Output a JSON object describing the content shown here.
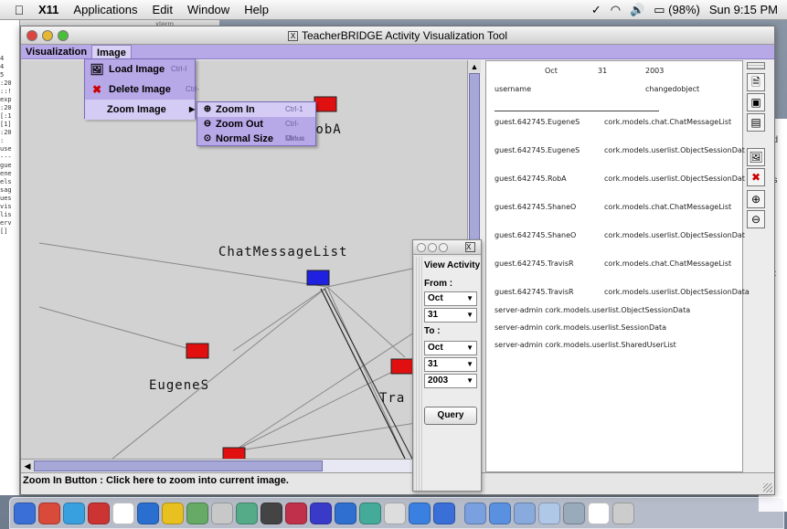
{
  "menubar": {
    "app": "X11",
    "items": [
      "Applications",
      "Edit",
      "Window",
      "Help"
    ],
    "battery": "(98%)",
    "clock": "Sun 9:15 PM"
  },
  "xterm": {
    "title": "xterm",
    "lines": [
      "4",
      "4",
      "5",
      ":20",
      "::!",
      "exp",
      ":20",
      "[:1",
      "[1]",
      ":20",
      ":",
      "use",
      "---",
      "",
      "gue",
      "ene",
      "els",
      "sag",
      "ues",
      "vis",
      "lis",
      "erv",
      "[]"
    ]
  },
  "window": {
    "title": "TeacherBRIDGE Activity Visualization Tool",
    "menus": [
      "Visualization",
      "Image"
    ]
  },
  "image_menu": {
    "items": [
      {
        "label": "Load Image",
        "accel": "Ctrl-I",
        "icon": "load-image-icon"
      },
      {
        "label": "Delete Image",
        "accel": "Ctrl-D",
        "icon": "delete-image-icon"
      },
      {
        "label": "Zoom Image",
        "accel": "",
        "icon": ""
      }
    ],
    "zoom_submenu": [
      {
        "label": "Zoom In",
        "accel": "Ctrl-1",
        "icon": "zoom-in-icon"
      },
      {
        "label": "Zoom Out",
        "accel": "Ctrl-Minus",
        "icon": "zoom-out-icon"
      },
      {
        "label": "Normal Size",
        "accel": "Ctrl-=",
        "icon": "normal-size-icon"
      }
    ]
  },
  "graph_labels": {
    "robA": "RobA",
    "chat": "ChatMessageList",
    "eugene": "EugeneS",
    "travis": "Tra"
  },
  "log": {
    "date": [
      "Oct",
      "31",
      "2003"
    ],
    "headers": [
      "username",
      "changedobject"
    ],
    "rows": [
      [
        "guest.642745.EugeneS",
        "cork.models.chat.ChatMessageList"
      ],
      [
        "guest.642745.EugeneS",
        "cork.models.userlist.ObjectSessionData"
      ],
      [
        "guest.642745.RobA",
        "cork.models.userlist.ObjectSessionData"
      ],
      [
        "guest.642745.ShaneO",
        "cork.models.chat.ChatMessageList"
      ],
      [
        "guest.642745.ShaneO",
        "cork.models.userlist.ObjectSessionData"
      ],
      [
        "guest.642745.TravisR",
        "cork.models.chat.ChatMessageList"
      ],
      [
        "guest.642745.TravisR",
        "cork.models.userlist.ObjectSessionData"
      ]
    ],
    "server_rows": [
      "server-admin  cork.models.userlist.ObjectSessionData",
      "server-admin  cork.models.userlist.SessionData",
      "server-admin  cork.models.userlist.SharedUserList"
    ]
  },
  "view_activity": {
    "title": "View Activity",
    "from_label": "From :",
    "to_label": "To :",
    "from_month": "Oct",
    "from_day": "31",
    "to_month": "Oct",
    "to_day": "31",
    "to_year": "2003",
    "query": "Query"
  },
  "behind": {
    "od": "od",
    "as": "as",
    "c": "C",
    "par": "par"
  },
  "status": "Zoom In Button : Click here to zoom into current image.",
  "colors": {
    "menu": "#b7a8e8",
    "node_red": "#e01010",
    "node_blue": "#2020e0"
  }
}
